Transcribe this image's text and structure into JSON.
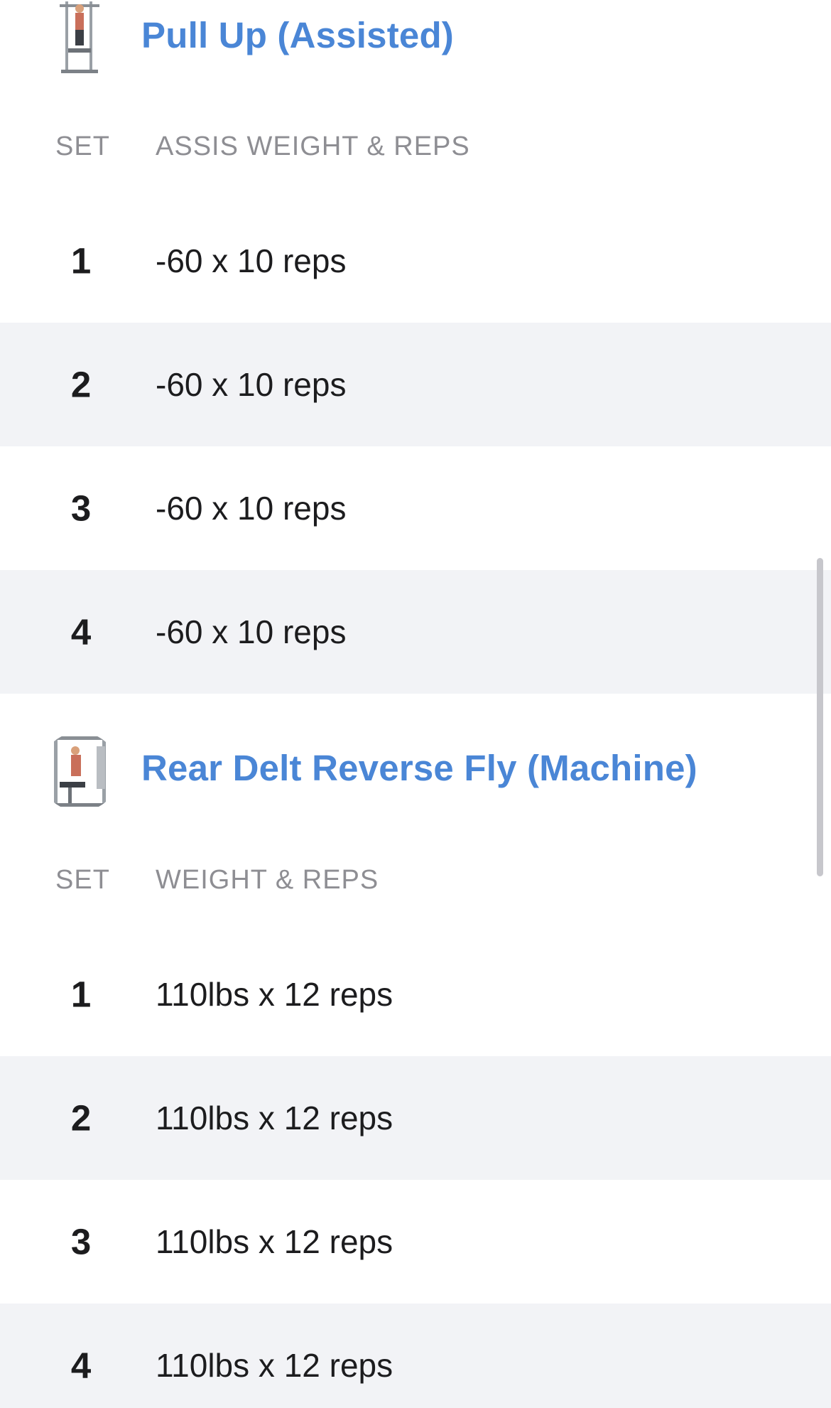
{
  "exercises": [
    {
      "title": "Pull Up (Assisted)",
      "icon": "pull-up-machine-icon",
      "col_set": "SET",
      "col_value": "ASSIS WEIGHT & REPS",
      "sets": [
        {
          "num": "1",
          "value": "-60 x 10 reps"
        },
        {
          "num": "2",
          "value": "-60 x 10 reps"
        },
        {
          "num": "3",
          "value": "-60 x 10 reps"
        },
        {
          "num": "4",
          "value": "-60 x 10 reps"
        }
      ]
    },
    {
      "title": "Rear Delt Reverse Fly (Machine)",
      "icon": "rear-delt-machine-icon",
      "col_set": "SET",
      "col_value": "WEIGHT & REPS",
      "sets": [
        {
          "num": "1",
          "value": "110lbs x 12 reps"
        },
        {
          "num": "2",
          "value": "110lbs x 12 reps"
        },
        {
          "num": "3",
          "value": "110lbs x 12 reps"
        },
        {
          "num": "4",
          "value": "110lbs x 12 reps"
        }
      ]
    }
  ],
  "colors": {
    "title": "#4a86d6",
    "header_text": "#8e8e93",
    "alt_row": "#f2f3f6"
  }
}
